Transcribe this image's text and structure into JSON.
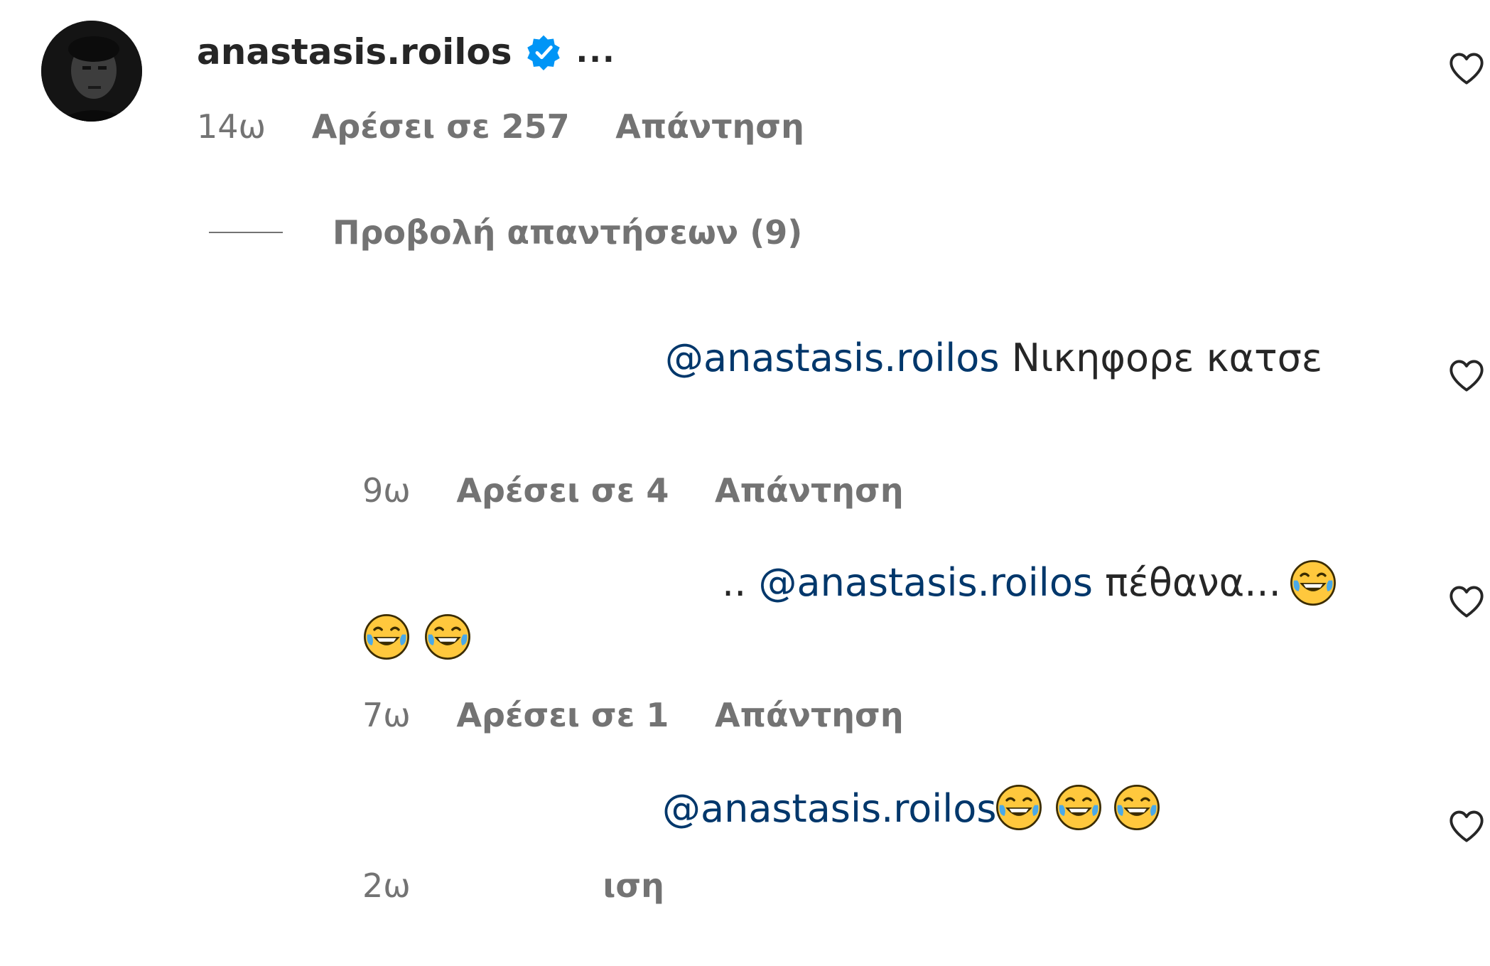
{
  "comment": {
    "username": "anastasis.roilos",
    "more_label": "...",
    "time": "14ω",
    "likes": "Αρέσει σε 257",
    "reply": "Απάντηση"
  },
  "view_replies": {
    "label": "Προβολή απαντήσεων (9)"
  },
  "replies": [
    {
      "mention": "@anastasis.roilos",
      "text": " Νικηφορε κατσε",
      "emoji_count": 0,
      "time": "9ω",
      "likes": "Αρέσει σε 4",
      "reply": "Απάντηση"
    },
    {
      "prefix": "..",
      "mention": "@anastasis.roilos",
      "text": " πέθανα... ",
      "emoji_count": 3,
      "time": "7ω",
      "likes": "Αρέσει σε 1",
      "reply": "Απάντηση"
    },
    {
      "mention": "@anastasis.roilos",
      "text": " ",
      "emoji_count": 3,
      "time": "2ω",
      "reply_partial": "ιση"
    }
  ],
  "colors": {
    "text": "#262626",
    "secondary": "#737373",
    "mention": "#00376b",
    "verified": "#0095f6"
  },
  "icons": {
    "verified": "verified-badge-icon",
    "heart": "heart-outline-icon",
    "emoji": "face-with-tears-of-joy-emoji"
  }
}
